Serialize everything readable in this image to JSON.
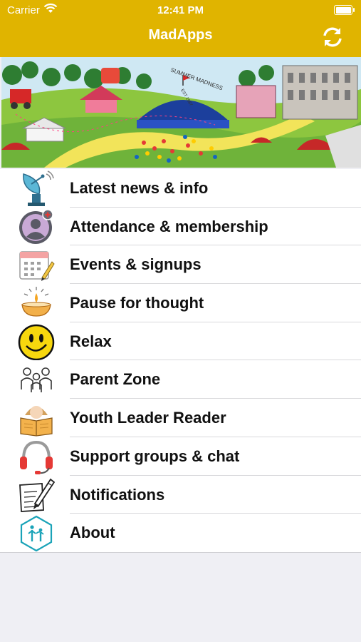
{
  "status": {
    "carrier": "Carrier",
    "time": "12:41 PM"
  },
  "nav": {
    "title": "MadApps",
    "refresh_icon": "refresh-icon"
  },
  "banner": {
    "sign_text": "SUMMER MADNESS",
    "est_text": "EST 1987"
  },
  "menu": {
    "items": [
      {
        "label": "Latest news & info",
        "icon": "satellite-dish-icon"
      },
      {
        "label": "Attendance & membership",
        "icon": "user-add-icon"
      },
      {
        "label": "Events & signups",
        "icon": "calendar-icon"
      },
      {
        "label": "Pause for thought",
        "icon": "candle-icon"
      },
      {
        "label": "Relax",
        "icon": "smiley-icon"
      },
      {
        "label": "Parent Zone",
        "icon": "family-icon"
      },
      {
        "label": "Youth Leader Reader",
        "icon": "reader-icon"
      },
      {
        "label": "Support groups & chat",
        "icon": "headset-icon"
      },
      {
        "label": "Notifications",
        "icon": "notepad-icon"
      },
      {
        "label": "About",
        "icon": "about-icon"
      }
    ]
  },
  "colors": {
    "nav_bar": "#e0b400",
    "background": "#efeff4",
    "text": "#111111"
  }
}
